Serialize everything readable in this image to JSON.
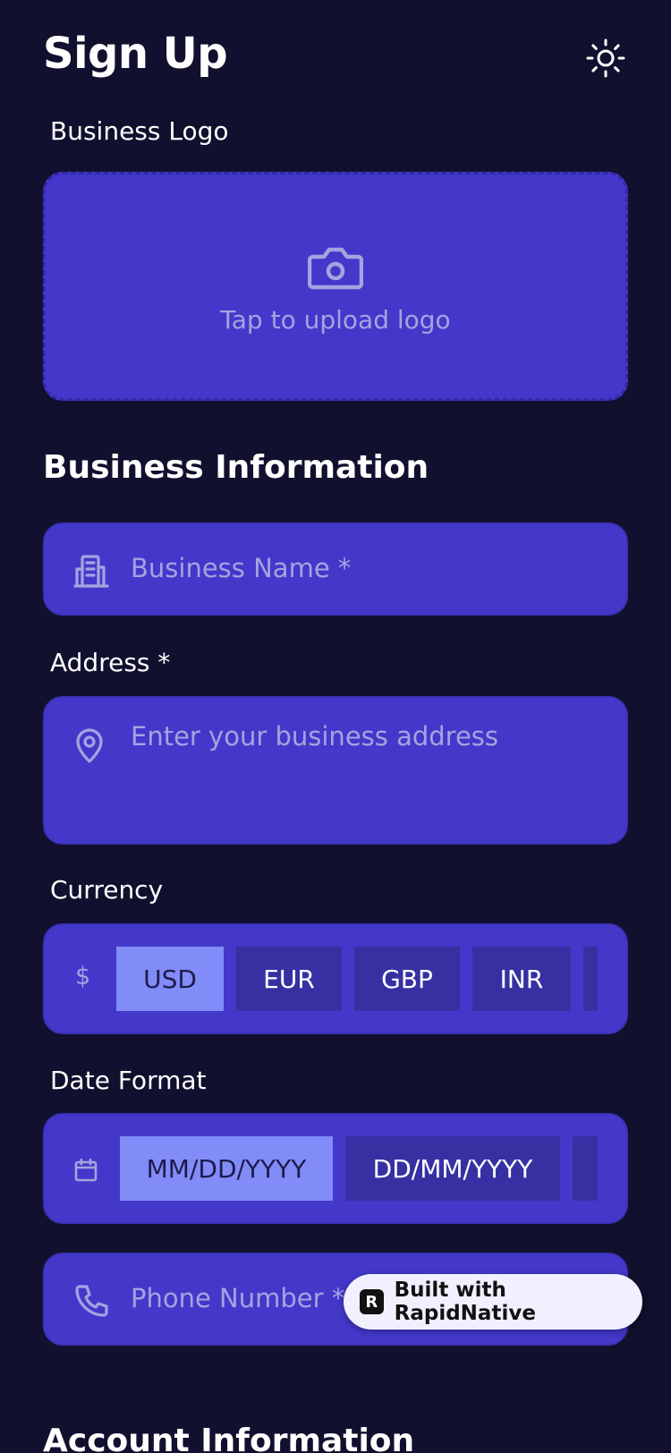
{
  "header": {
    "title": "Sign Up"
  },
  "logo_section": {
    "label": "Business Logo",
    "upload_text": "Tap to upload logo"
  },
  "business_section": {
    "title": "Business Information",
    "business_name_placeholder": "Business Name *",
    "address_label": "Address *",
    "address_placeholder": "Enter your business address",
    "currency_label": "Currency",
    "currency_symbol": "$",
    "currencies": [
      "USD",
      "EUR",
      "GBP",
      "INR"
    ],
    "selected_currency": "USD",
    "date_format_label": "Date Format",
    "date_formats": [
      "MM/DD/YYYY",
      "DD/MM/YYYY"
    ],
    "selected_date_format": "MM/DD/YYYY",
    "phone_placeholder": "Phone Number *"
  },
  "account_section": {
    "title": "Account Information"
  },
  "badge": {
    "text": "Built with RapidNative",
    "logo_glyph": "R"
  },
  "colors": {
    "background": "#11102e",
    "field_background": "#4338ca",
    "chip_background": "#3730a3",
    "chip_active": "#818cf8",
    "placeholder": "#a5a3e0"
  },
  "icons": {
    "theme_toggle": "sun-icon",
    "upload": "camera-icon",
    "business_name": "building-icon",
    "address": "map-pin-icon",
    "date_format": "calendar-icon",
    "phone": "phone-icon"
  }
}
